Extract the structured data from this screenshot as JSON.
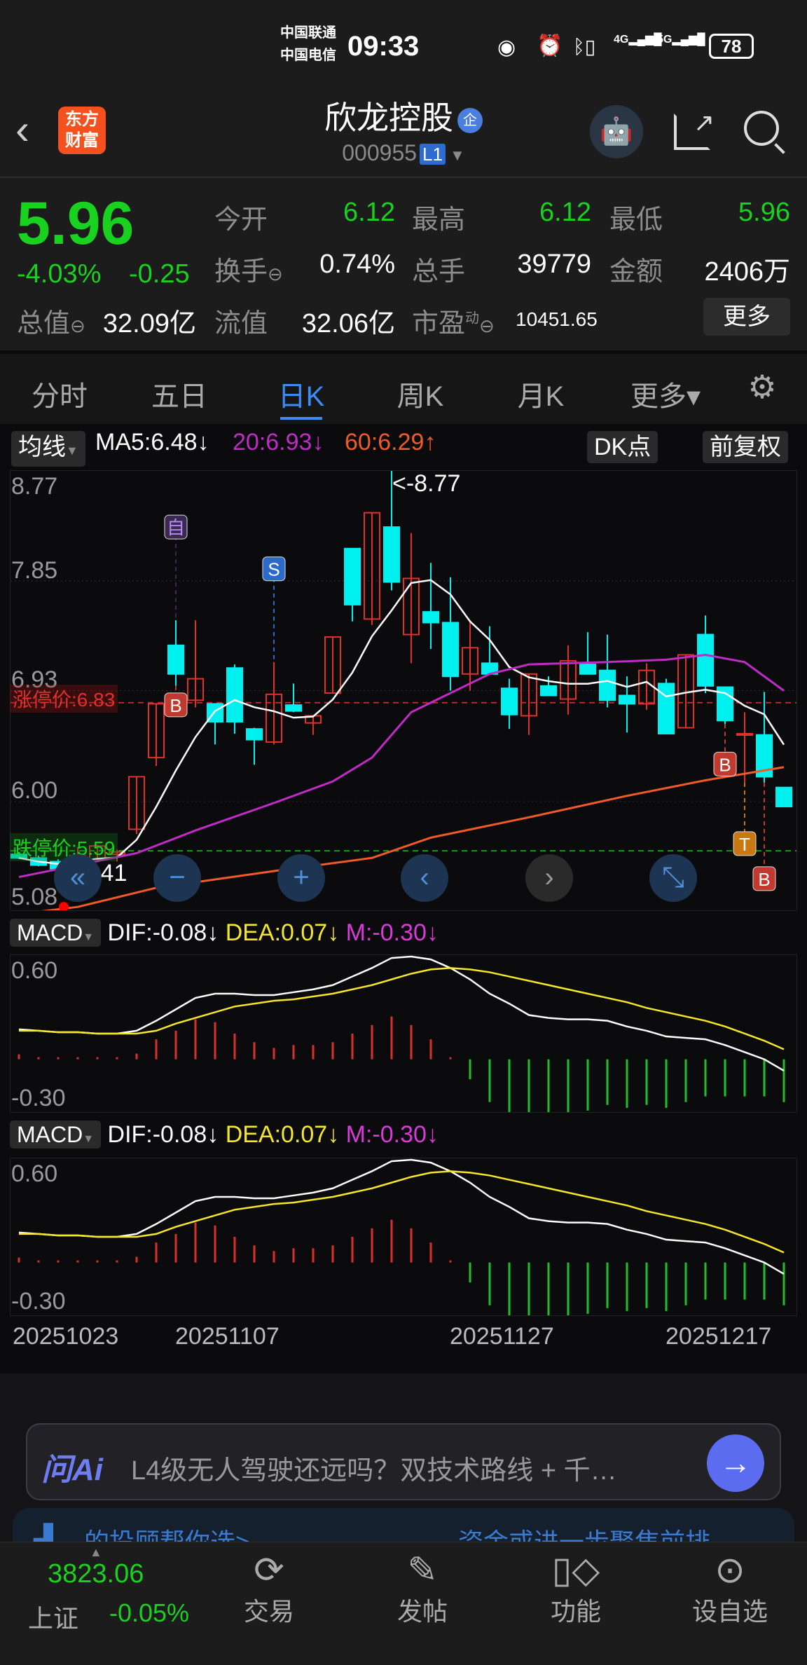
{
  "status_bar": {
    "carrier1": "中国联通",
    "carrier2": "中国电信",
    "time": "09:33",
    "net1": "4G",
    "net2": "5G",
    "battery": "78"
  },
  "header": {
    "logo": "东方财富",
    "title": "欣龙控股",
    "title_badge": "企",
    "code": "000955",
    "level": "L1",
    "icons": [
      "back-icon",
      "robot-avatar",
      "share-icon",
      "search-icon"
    ]
  },
  "quote": {
    "price": "5.96",
    "change_pct": "-4.03%",
    "change": "-0.25",
    "fields": [
      {
        "label": "今开",
        "value": "6.12",
        "color": "green"
      },
      {
        "label": "最高",
        "value": "6.12",
        "color": "green"
      },
      {
        "label": "最低",
        "value": "5.96",
        "color": "green"
      },
      {
        "label": "换手",
        "value": "0.74%"
      },
      {
        "label": "总手",
        "value": "39779"
      },
      {
        "label": "金额",
        "value": "2406万"
      },
      {
        "label": "总值",
        "value": "32.09亿"
      },
      {
        "label": "流值",
        "value": "32.06亿"
      },
      {
        "label": "市盈",
        "sup": "动",
        "value": "10451.65"
      }
    ],
    "more": "更多"
  },
  "tabs": [
    {
      "label": "分时"
    },
    {
      "label": "五日"
    },
    {
      "label": "日K",
      "active": true
    },
    {
      "label": "周K"
    },
    {
      "label": "月K"
    },
    {
      "label": "更多▾"
    }
  ],
  "ma_bar": {
    "selector": "均线",
    "ma5": "MA5:6.48↓",
    "ma20": "20:6.93↓",
    "ma60": "60:6.29↑",
    "dk": "DK点",
    "adjust": "前复权"
  },
  "colors": {
    "up": "#e0302a",
    "down": "#00f0f0",
    "ma5": "#ffffff",
    "ma20": "#c02bc8",
    "ma60": "#f05a28",
    "dif": "#ffffff",
    "dea": "#f5e62a",
    "accent": "#3b8df5",
    "green": "#19d11f"
  },
  "chart_data": [
    {
      "type": "candlestick",
      "ylim": [
        5.08,
        8.77
      ],
      "y_ticks": [
        "8.77",
        "7.85",
        "6.93",
        "6.00",
        "5.08"
      ],
      "limit_up": {
        "label": "涨停价:6.83",
        "value": 6.83
      },
      "limit_down": {
        "label": "跌停价:5.59",
        "value": 5.59
      },
      "high_note": "<-8.77",
      "low_note": "<-5.41",
      "ohlc": [
        [
          5.56,
          5.58,
          5.52,
          5.53
        ],
        [
          5.53,
          5.55,
          5.46,
          5.47
        ],
        [
          5.5,
          5.52,
          5.41,
          5.44
        ],
        [
          5.48,
          5.62,
          5.4,
          5.55
        ],
        [
          5.52,
          5.64,
          5.5,
          5.63
        ],
        [
          5.56,
          5.6,
          5.5,
          5.58
        ],
        [
          5.77,
          6.21,
          5.73,
          6.21
        ],
        [
          6.37,
          6.82,
          6.3,
          6.82
        ],
        [
          7.31,
          7.52,
          6.97,
          7.07
        ],
        [
          6.85,
          7.52,
          6.79,
          7.03
        ],
        [
          6.82,
          6.82,
          6.48,
          6.67
        ],
        [
          7.12,
          7.15,
          6.57,
          6.67
        ],
        [
          6.61,
          6.62,
          6.31,
          6.52
        ],
        [
          6.5,
          7.17,
          6.48,
          6.9
        ],
        [
          6.81,
          6.99,
          6.75,
          6.76
        ],
        [
          6.66,
          6.72,
          6.56,
          6.72
        ],
        [
          6.91,
          7.38,
          6.91,
          7.38
        ],
        [
          8.12,
          8.12,
          7.51,
          7.65
        ],
        [
          7.53,
          8.42,
          7.48,
          8.42
        ],
        [
          8.3,
          8.77,
          7.77,
          7.84
        ],
        [
          7.4,
          8.25,
          7.16,
          7.87
        ],
        [
          7.59,
          8.0,
          7.28,
          7.5
        ],
        [
          7.5,
          7.88,
          6.93,
          7.05
        ],
        [
          7.07,
          7.52,
          6.93,
          7.29
        ],
        [
          7.16,
          7.47,
          7.07,
          7.07
        ],
        [
          6.95,
          7.03,
          6.61,
          6.73
        ],
        [
          6.72,
          7.07,
          6.56,
          7.07
        ],
        [
          6.97,
          7.05,
          6.89,
          6.89
        ],
        [
          6.86,
          7.31,
          6.73,
          7.18
        ],
        [
          7.15,
          7.42,
          7.07,
          7.07
        ],
        [
          7.1,
          7.4,
          6.79,
          6.85
        ],
        [
          6.89,
          7.05,
          6.58,
          6.82
        ],
        [
          6.82,
          7.16,
          6.77,
          7.1
        ],
        [
          6.99,
          7.03,
          6.57,
          6.57
        ],
        [
          6.62,
          7.23,
          6.62,
          7.23
        ],
        [
          7.4,
          7.56,
          6.91,
          6.97
        ],
        [
          6.96,
          6.96,
          6.65,
          6.68
        ],
        [
          6.57,
          6.75,
          6.16,
          6.57
        ],
        [
          6.56,
          6.92,
          6.16,
          6.21
        ],
        [
          6.12,
          6.12,
          5.96,
          5.96
        ]
      ],
      "ma20": [
        [
          0,
          5.37
        ],
        [
          6,
          5.57
        ],
        [
          9,
          5.76
        ],
        [
          13,
          5.99
        ],
        [
          16,
          6.17
        ],
        [
          18,
          6.37
        ],
        [
          20,
          6.75
        ],
        [
          22,
          6.91
        ],
        [
          24,
          7.07
        ],
        [
          26,
          7.15
        ],
        [
          30,
          7.17
        ],
        [
          33,
          7.19
        ],
        [
          35,
          7.23
        ],
        [
          37,
          7.17
        ],
        [
          39,
          6.93
        ]
      ],
      "ma60": [
        [
          0,
          5.06
        ],
        [
          3,
          5.12
        ],
        [
          7,
          5.28
        ],
        [
          13,
          5.42
        ],
        [
          18,
          5.53
        ],
        [
          21,
          5.7
        ],
        [
          26,
          5.87
        ],
        [
          31,
          6.05
        ],
        [
          35,
          6.18
        ],
        [
          39,
          6.29
        ]
      ],
      "signals": [
        {
          "index": 8,
          "label": "自",
          "pos": "top"
        },
        {
          "index": 13,
          "label": "S",
          "pos": "top"
        },
        {
          "index": 8,
          "label": "B",
          "pos": "bottom"
        },
        {
          "index": 36,
          "label": "B",
          "pos": "bottom"
        },
        {
          "index": 37,
          "label": "T",
          "pos": "bottom"
        },
        {
          "index": 38,
          "label": "B",
          "pos": "bottom"
        }
      ]
    },
    {
      "type": "macd",
      "header": {
        "name": "MACD",
        "dif": "DIF:-0.08↓",
        "dea": "DEA:0.07↓",
        "m": "M:-0.30↓"
      },
      "y_ticks": [
        "0.60",
        "-0.30"
      ],
      "ylim": [
        -0.38,
        0.73
      ],
      "dif": [
        0.21,
        0.2,
        0.19,
        0.19,
        0.18,
        0.18,
        0.2,
        0.27,
        0.35,
        0.43,
        0.46,
        0.46,
        0.45,
        0.45,
        0.47,
        0.49,
        0.52,
        0.58,
        0.64,
        0.71,
        0.72,
        0.7,
        0.64,
        0.56,
        0.46,
        0.39,
        0.31,
        0.29,
        0.28,
        0.28,
        0.27,
        0.23,
        0.2,
        0.16,
        0.15,
        0.14,
        0.1,
        0.05,
        0.0,
        -0.08
      ],
      "dea": [
        0.2,
        0.2,
        0.19,
        0.19,
        0.18,
        0.18,
        0.18,
        0.2,
        0.25,
        0.29,
        0.33,
        0.37,
        0.39,
        0.41,
        0.42,
        0.44,
        0.46,
        0.49,
        0.52,
        0.56,
        0.6,
        0.63,
        0.64,
        0.63,
        0.61,
        0.58,
        0.55,
        0.52,
        0.49,
        0.46,
        0.43,
        0.4,
        0.36,
        0.33,
        0.3,
        0.27,
        0.23,
        0.18,
        0.13,
        0.07
      ]
    }
  ],
  "dates": [
    "20251023",
    "20251107",
    "20251127",
    "20251217"
  ],
  "chart_controls": [
    "double-chevron-left-icon",
    "zoom-out-icon",
    "zoom-in-icon",
    "chevron-left-icon",
    "chevron-right-icon",
    "fullscreen-icon"
  ],
  "ai": {
    "logo": "问Ai",
    "prompt": "L4级无人驾驶还远吗？双技术路线 + 千…"
  },
  "banner": {
    "left": "的投顾帮你选>",
    "right": "资金或进一步聚焦前排"
  },
  "nav": {
    "index_value": "3823.06",
    "index_name": "上证",
    "index_change": "-0.05%",
    "items": [
      {
        "label": "交易"
      },
      {
        "label": "发帖"
      },
      {
        "label": "功能"
      },
      {
        "label": "设自选"
      }
    ]
  }
}
